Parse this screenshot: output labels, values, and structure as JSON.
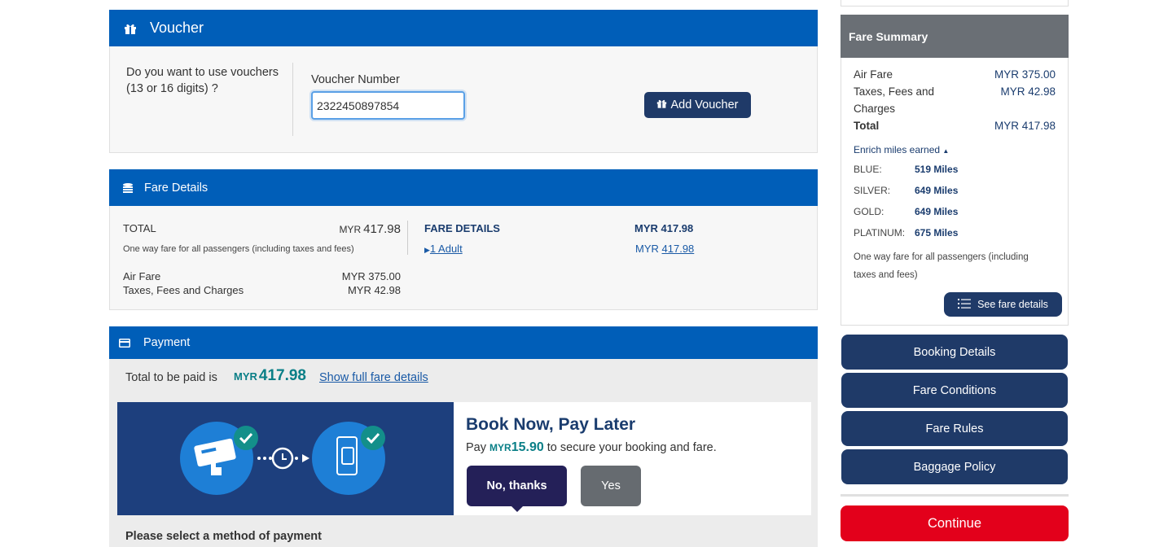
{
  "voucher": {
    "title": "Voucher",
    "question": "Do you want to use vouchers (13 or 16 digits) ?",
    "number_label": "Voucher Number",
    "number_value": "2322450897854",
    "add_button": "Add Voucher"
  },
  "fare_details": {
    "title": "Fare Details",
    "total_label": "TOTAL",
    "total_currency": "MYR",
    "total_amount": "417.98",
    "one_way_note": "One way fare for all passengers (including taxes and fees)",
    "air_fare_label": "Air Fare",
    "air_fare_value": "MYR 375.00",
    "taxes_label": "Taxes, Fees and Charges",
    "taxes_value": "MYR 42.98",
    "details_label": "FARE DETAILS",
    "details_amount": "MYR 417.98",
    "adult_link": "1 Adult",
    "adult_currency": "MYR",
    "adult_amount": "417.98"
  },
  "payment": {
    "title": "Payment",
    "total_label": "Total to be paid is",
    "total_currency": "MYR",
    "total_amount": "417.98",
    "show_full_link": "Show full fare details",
    "bnpl_title": "Book Now, Pay Later",
    "bnpl_pay": "Pay",
    "bnpl_currency": "MYR",
    "bnpl_amount": "15.90",
    "bnpl_suffix": "to secure your booking and fare.",
    "no_thanks": "No, thanks",
    "yes": "Yes",
    "select_method": "Please select a method of payment"
  },
  "fare_summary": {
    "title": "Fare Summary",
    "air_fare_label": "Air Fare",
    "air_fare_value": "MYR 375.00",
    "taxes_label_1": "Taxes, Fees and",
    "taxes_label_2": "Charges",
    "taxes_value": "MYR 42.98",
    "total_label": "Total",
    "total_value": "MYR 417.98",
    "miles_heading": "Enrich miles earned",
    "tiers": [
      {
        "label": "BLUE:",
        "miles": "519 Miles"
      },
      {
        "label": "SILVER:",
        "miles": "649 Miles"
      },
      {
        "label": "GOLD:",
        "miles": "649 Miles"
      },
      {
        "label": "PLATINUM:",
        "miles": "675 Miles"
      }
    ],
    "one_way_note": "One way fare for all passengers (including taxes and fees)",
    "see_fare_button": "See fare details"
  },
  "side_nav": {
    "booking_details": "Booking Details",
    "fare_conditions": "Fare Conditions",
    "fare_rules": "Fare Rules",
    "baggage_policy": "Baggage Policy",
    "continue": "Continue"
  },
  "colors": {
    "header_blue": "#005eb8",
    "navy_button": "#1f3a68",
    "teal_amount": "#0a7f87",
    "continue_red": "#e3001b",
    "summary_grey": "#6a6f75"
  }
}
